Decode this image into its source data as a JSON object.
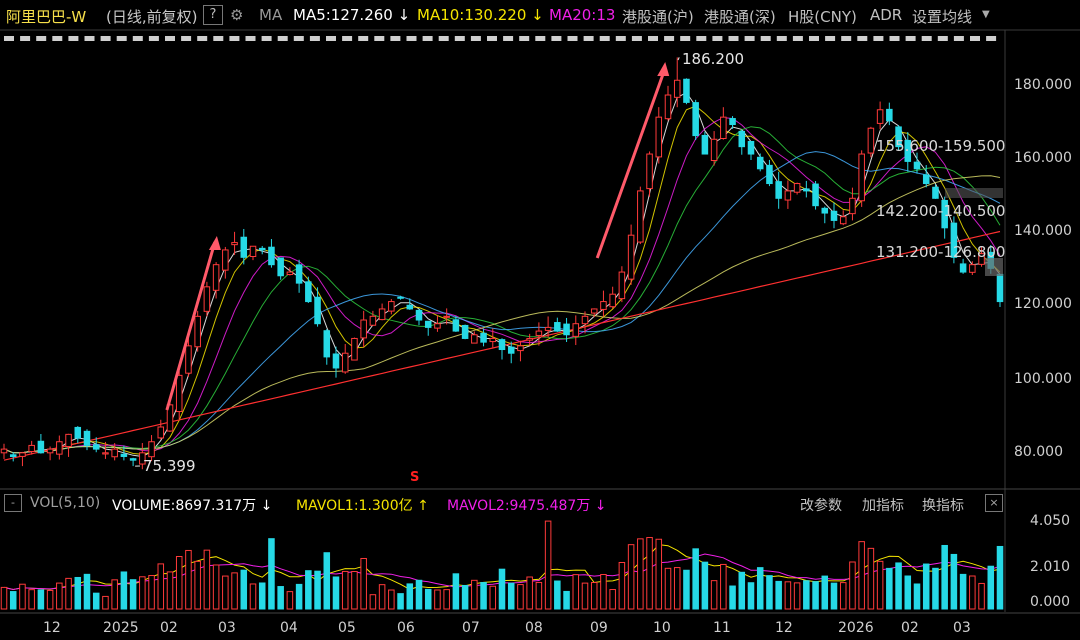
{
  "header": {
    "stock_name": "阿里巴巴-W",
    "period": "(日线,前复权)",
    "help": "?",
    "ma_label": "MA",
    "ma5": "MA5:127.260 ↓",
    "ma10": "MA10:130.220 ↓",
    "ma20": "MA20:13",
    "links": [
      "港股通(沪)",
      "港股通(深)",
      "H股(CNY)",
      "ADR",
      "设置均线"
    ]
  },
  "volume_header": {
    "box": "-",
    "title": "VOL(5,10)",
    "volume": "VOLUME:8697.317万 ↓",
    "mavol1": "MAVOL1:1.300亿 ↑",
    "mavol2": "MAVOL2:9475.487万 ↓",
    "buttons": [
      "改参数",
      "加指标",
      "换指标"
    ],
    "close": "×"
  },
  "colors": {
    "up": "#ff3a3a",
    "down": "#26d9e6",
    "ma5": "#ffffff",
    "ma10": "#f5e400",
    "ma20": "#f020e8",
    "ma30": "#2ecc40",
    "ma60": "#45b0ff",
    "ma120": "#d9d96a",
    "ma250": "#ff3030",
    "arrow": "#ff5a6a"
  },
  "annotations": {
    "high": "186.200",
    "low": "75.399",
    "levels": [
      "155.600-159.500",
      "142.200-140.500",
      "131.200-126.800"
    ],
    "event_mark": "S"
  },
  "chart_data": [
    {
      "type": "candlestick",
      "ylim": [
        70,
        192
      ],
      "y_ticks": [
        "180.000",
        "160.000",
        "140.000",
        "120.000",
        "100.000",
        "80.000"
      ],
      "x_ticks": [
        "12",
        "2025",
        "02",
        "03",
        "04",
        "05",
        "06",
        "07",
        "08",
        "09",
        "10",
        "11",
        "12",
        "2026",
        "02",
        "03"
      ],
      "closes": [
        80,
        78,
        79,
        81,
        79,
        80,
        82,
        84,
        83,
        81,
        80,
        79,
        80,
        78,
        77,
        79,
        82,
        86,
        92,
        100,
        108,
        116,
        124,
        130,
        134,
        136,
        132,
        135,
        134,
        130,
        127,
        128,
        125,
        120,
        114,
        105,
        102,
        106,
        110,
        115,
        116,
        118,
        120,
        121,
        118,
        115,
        113,
        114,
        116,
        112,
        110,
        111,
        109,
        110,
        107,
        106,
        108,
        110,
        112,
        113,
        112,
        111,
        114,
        116,
        118,
        120,
        122,
        128,
        138,
        150,
        160,
        170,
        176,
        180,
        174,
        165,
        160,
        164,
        170,
        168,
        162,
        160,
        156,
        152,
        148,
        150,
        152,
        150,
        146,
        144,
        142,
        143,
        148,
        160,
        167,
        172,
        169,
        162,
        158,
        156,
        152,
        148,
        140,
        132,
        128,
        130,
        133,
        129,
        120
      ],
      "high": 186.2,
      "low": 75.399,
      "moving_averages": [
        "MA5",
        "MA10",
        "MA20",
        "MA30",
        "MA60",
        "MA120",
        "MA250"
      ]
    },
    {
      "type": "bar",
      "title": "VOL(5,10)",
      "ylim": [
        0,
        4.05
      ],
      "y_ticks": [
        "4.050",
        "2.010",
        "0.000"
      ],
      "ma_periods": [
        5,
        10
      ]
    }
  ]
}
